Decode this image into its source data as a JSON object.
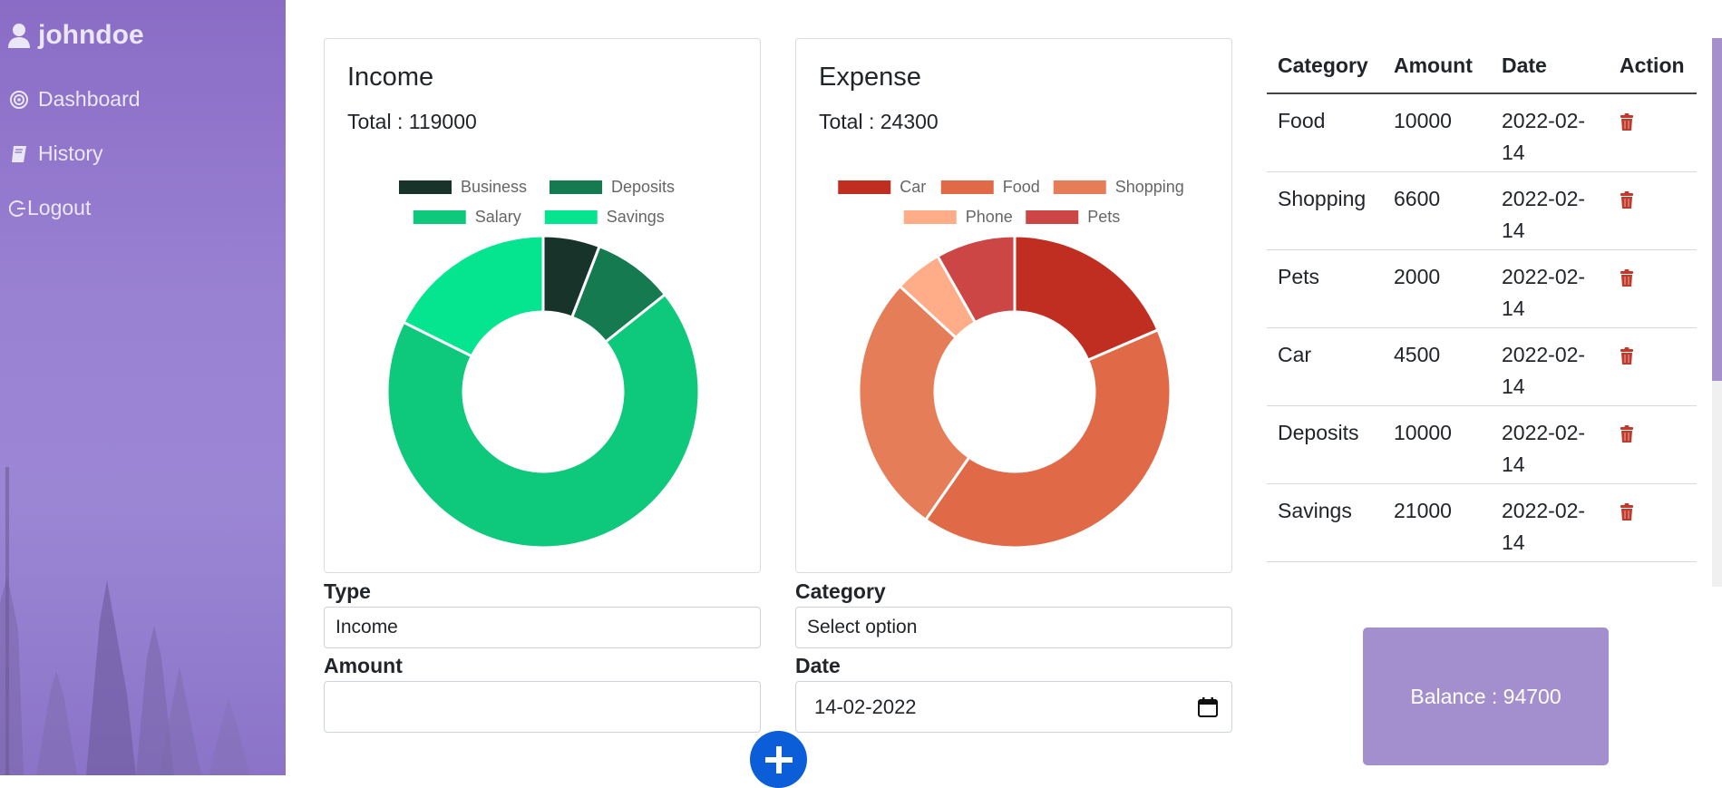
{
  "user": {
    "name": "johndoe",
    "icon": "user-icon"
  },
  "nav": [
    {
      "label": "Dashboard",
      "icon": "dashboard-icon"
    },
    {
      "label": "History",
      "icon": "book-icon"
    },
    {
      "label": "Logout",
      "icon": "logout-icon"
    }
  ],
  "income": {
    "title": "Income",
    "total": "Total : 119000"
  },
  "expense": {
    "title": "Expense",
    "total": "Total : 24300"
  },
  "chart_data": [
    {
      "type": "doughnut",
      "title": "Income",
      "legend_position": "top",
      "series": [
        {
          "name": "Business",
          "value": 7000,
          "color": "#18332a"
        },
        {
          "name": "Deposits",
          "value": 10000,
          "color": "#167a50"
        },
        {
          "name": "Salary",
          "value": 81000,
          "color": "#0ec87b"
        },
        {
          "name": "Savings",
          "value": 21000,
          "color": "#05e48e"
        }
      ]
    },
    {
      "type": "doughnut",
      "title": "Expense",
      "legend_position": "top",
      "series": [
        {
          "name": "Car",
          "value": 4500,
          "color": "#c02e22"
        },
        {
          "name": "Food",
          "value": 10000,
          "color": "#e06a48"
        },
        {
          "name": "Shopping",
          "value": 6600,
          "color": "#e57d58"
        },
        {
          "name": "Phone",
          "value": 1200,
          "color": "#ffad88"
        },
        {
          "name": "Pets",
          "value": 2000,
          "color": "#cd4646"
        }
      ]
    }
  ],
  "form": {
    "type_label": "Type",
    "type_value": "Income",
    "category_label": "Category",
    "category_value": "Select option",
    "amount_label": "Amount",
    "amount_value": "",
    "date_label": "Date",
    "date_value": "14-02-2022",
    "add_icon": "plus-icon"
  },
  "table": {
    "headers": [
      "Category",
      "Amount",
      "Date",
      "Action"
    ],
    "rows": [
      {
        "category": "Food",
        "amount": "10000",
        "date": "2022-02-14"
      },
      {
        "category": "Shopping",
        "amount": "6600",
        "date": "2022-02-14"
      },
      {
        "category": "Pets",
        "amount": "2000",
        "date": "2022-02-14"
      },
      {
        "category": "Car",
        "amount": "4500",
        "date": "2022-02-14"
      },
      {
        "category": "Deposits",
        "amount": "10000",
        "date": "2022-02-14"
      },
      {
        "category": "Savings",
        "amount": "21000",
        "date": "2022-02-14"
      }
    ],
    "delete_icon": "trash-icon",
    "delete_color": "#c0392b"
  },
  "balance": {
    "text": "Balance : 94700"
  },
  "colors": {
    "sidebar": "#9a82d2",
    "accent": "#a48fce",
    "add_button": "#0b5ed7"
  }
}
